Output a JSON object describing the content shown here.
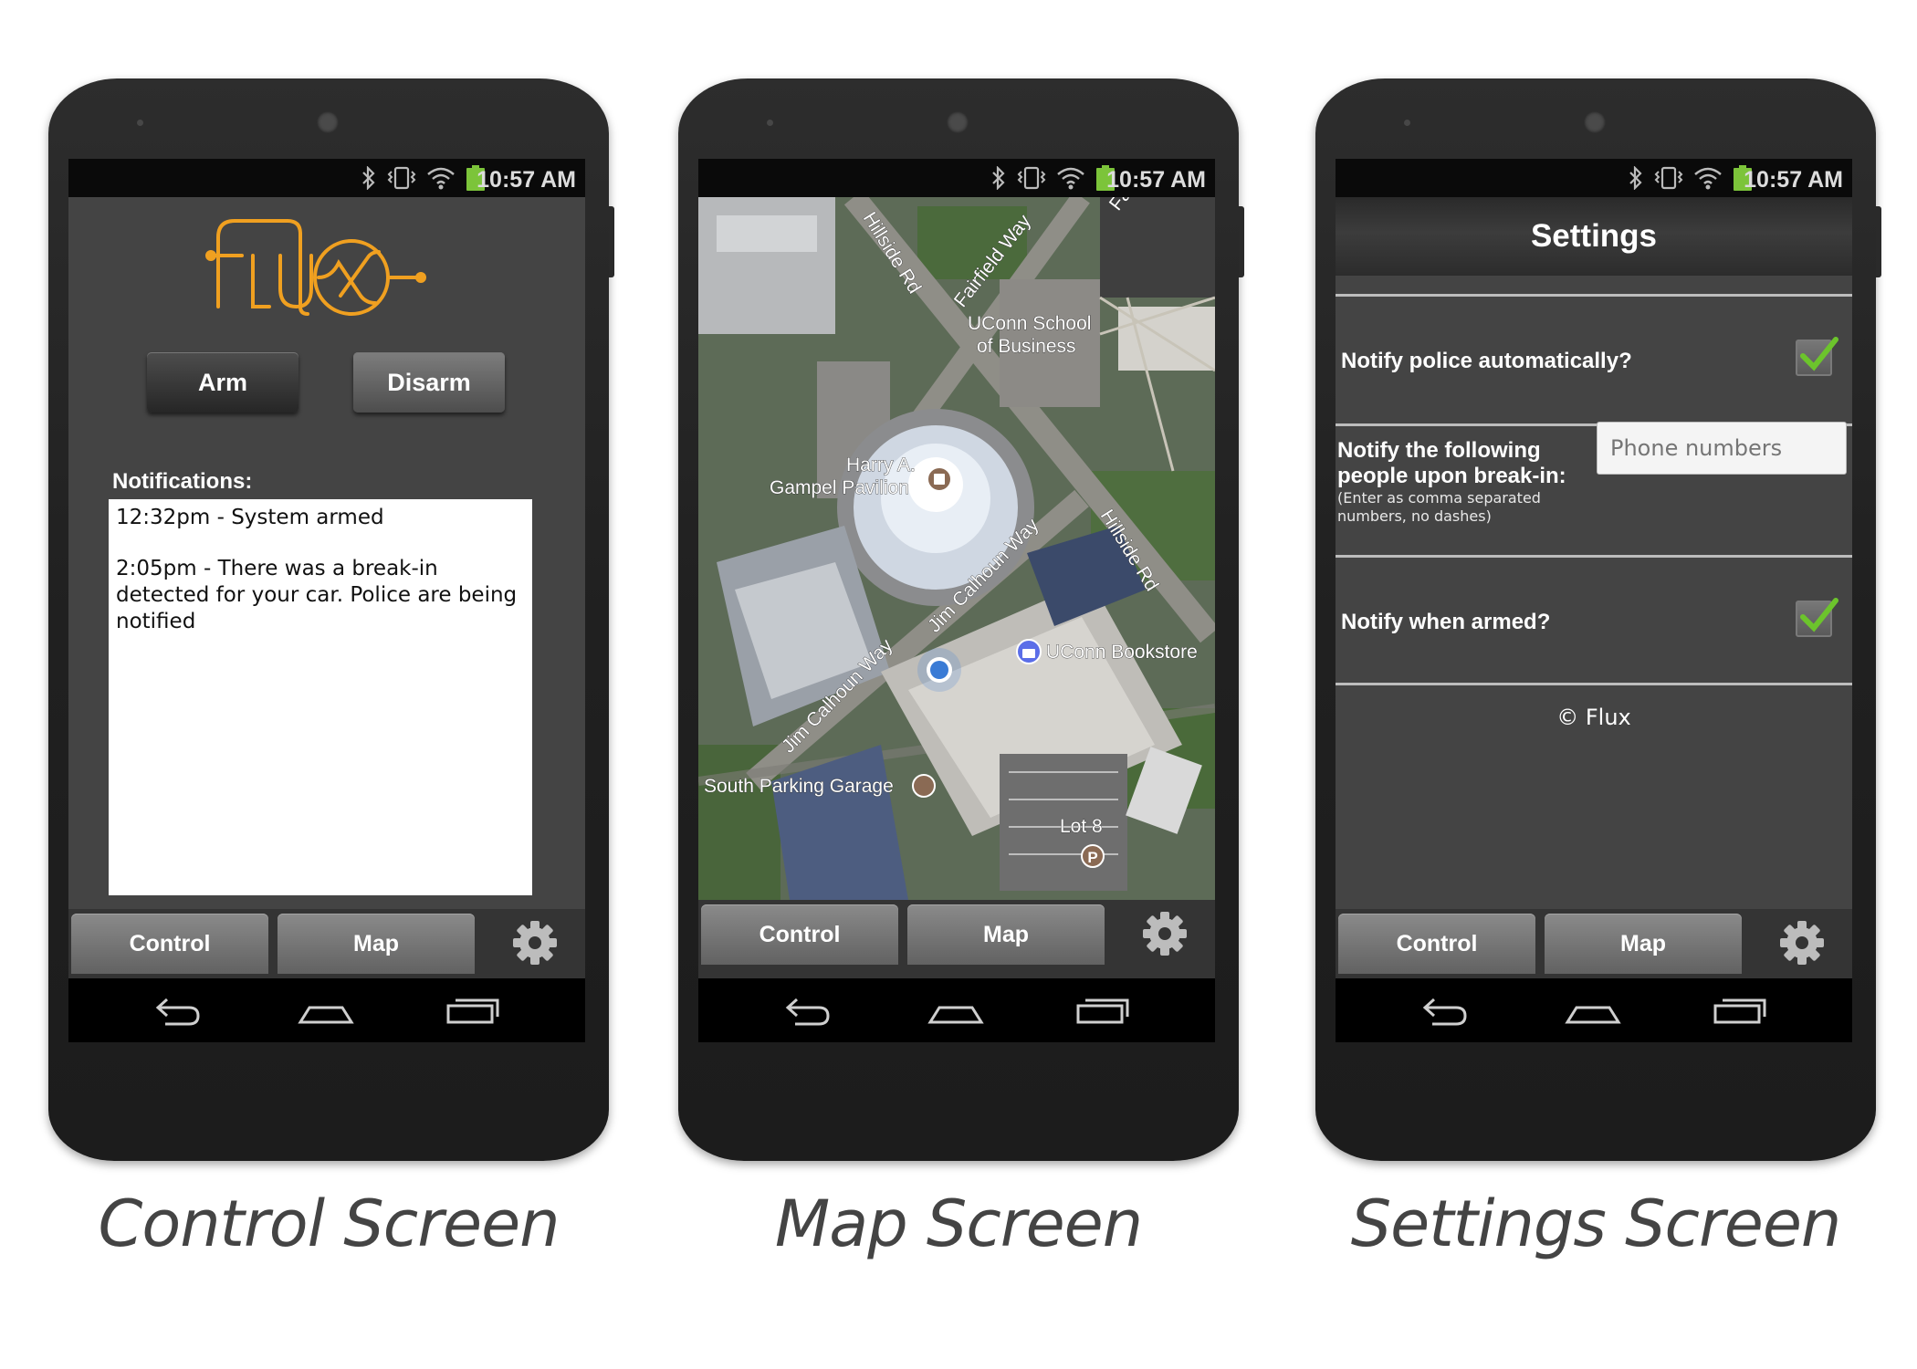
{
  "status_bar": {
    "time": "10:57 AM"
  },
  "tabs": {
    "control": "Control",
    "map": "Map"
  },
  "control_screen": {
    "logo_text": "FLUX",
    "arm_label": "Arm",
    "disarm_label": "Disarm",
    "notifications_label": "Notifications:",
    "notifications": [
      "12:32pm - System armed",
      "2:05pm - There was a break-in detected for your car. Police are being notified"
    ],
    "caption": "Control Screen"
  },
  "map_screen": {
    "labels": {
      "hillside_rd_top": "Hillside Rd",
      "fairfield_way": "Fairfield Way",
      "fa": "Fa",
      "school": "UConn School of Business",
      "school_line1": "UConn School",
      "school_line2": "of Business",
      "pavilion_line1": "Harry A.",
      "pavilion_line2": "Gampel Pavilion",
      "jim_calhoun_upper": "Jim Calhoun Way",
      "hillside_rd_lower": "Hillside Rd",
      "bookstore": "UConn Bookstore",
      "jim_calhoun_lower": "Jim Calhoun Way",
      "parking_garage": "South Parking Garage",
      "lot": "Lot 8",
      "parking_marker": "P"
    },
    "caption": "Map Screen"
  },
  "settings_screen": {
    "title": "Settings",
    "notify_police_label": "Notify police automatically?",
    "notify_police_checked": true,
    "notify_people_line1": "Notify the following",
    "notify_people_line2": "people upon break-in:",
    "notify_people_hint": "(Enter as comma separated numbers, no dashes)",
    "phone_placeholder": "Phone numbers",
    "notify_armed_label": "Notify when armed?",
    "notify_armed_checked": true,
    "copyright": "© Flux",
    "caption": "Settings Screen"
  },
  "colors": {
    "logo_orange": "#f0a020",
    "screen_bg": "#444444",
    "check_green": "#6cc42c",
    "location_blue": "#3a7bd5"
  },
  "icons": [
    "bluetooth-icon",
    "vibrate-icon",
    "wifi-icon",
    "battery-icon",
    "gear-icon",
    "back-icon",
    "home-icon",
    "recents-icon",
    "checkmark-icon",
    "location-dot-icon"
  ]
}
